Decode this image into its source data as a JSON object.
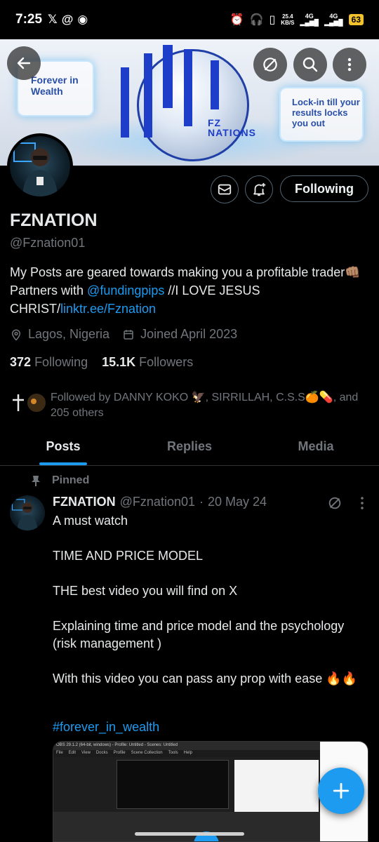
{
  "status_bar": {
    "time": "7:25",
    "left_icons": [
      "x-logo-icon",
      "threads-icon",
      "steam-icon"
    ],
    "right_icons": [
      "alarm-icon",
      "headphones-icon",
      "vibrate-icon",
      "signal-4g-icon",
      "signal-4g-icon"
    ],
    "net_speed_value": "25.4",
    "net_speed_unit": "KB/S",
    "network_label": "4G",
    "battery": "63"
  },
  "banner": {
    "left_badge": "Forever in Wealth",
    "right_badge": "Lock-in till your results locks you out",
    "logo_line1": "FZ",
    "logo_line2": "NATIONS"
  },
  "header_actions": {
    "back_icon": "arrow-left-icon",
    "grok_icon": "grok-icon",
    "search_icon": "search-icon",
    "more_icon": "more-vertical-icon"
  },
  "profile": {
    "name": "FZNATION",
    "handle": "@Fznation01",
    "bio_part1": "My Posts are geared towards making you a profitable trader👊🏽 Partners with ",
    "bio_mention": "@fundingpips",
    "bio_part2": " //I LOVE JESUS CHRIST/",
    "bio_link": "linktr.ee/Fznation",
    "location": "Lagos, Nigeria",
    "joined": "Joined April 2023",
    "following_count": "372",
    "following_label": "Following",
    "followers_count": "15.1K",
    "followers_label": "Followers",
    "followed_by": "Followed by DANNY KOKO 🦅, SIRRILLAH, C.S.S🍊💊, and 205 others",
    "follow_button": "Following"
  },
  "tabs": [
    {
      "label": "Posts",
      "active": true
    },
    {
      "label": "Replies",
      "active": false
    },
    {
      "label": "Media",
      "active": false
    }
  ],
  "post": {
    "pinned_label": "Pinned",
    "author_name": "FZNATION",
    "author_handle": "@Fznation01",
    "separator": "·",
    "date": "20 May 24",
    "body": "A must watch\n\nTIME AND PRICE MODEL\n\nTHE best video you will find on X\n\nExplaining time and price model and the psychology (risk management )\n\nWith this video you can pass any prop with ease 🔥🔥",
    "hashtag": "#forever_in_wealth",
    "media_title": "OBS 29.1.2 (64-bit, windows) - Profile: Untitled - Scenes: Untitled",
    "media_menu": [
      "File",
      "Edit",
      "View",
      "Docks",
      "Profile",
      "Scene Collection",
      "Tools",
      "Help"
    ]
  },
  "fab_icon": "plus-icon",
  "colors": {
    "accent": "#1d9bf0",
    "background": "#000000",
    "secondary_text": "#71767b",
    "battery": "#f2c12e"
  }
}
